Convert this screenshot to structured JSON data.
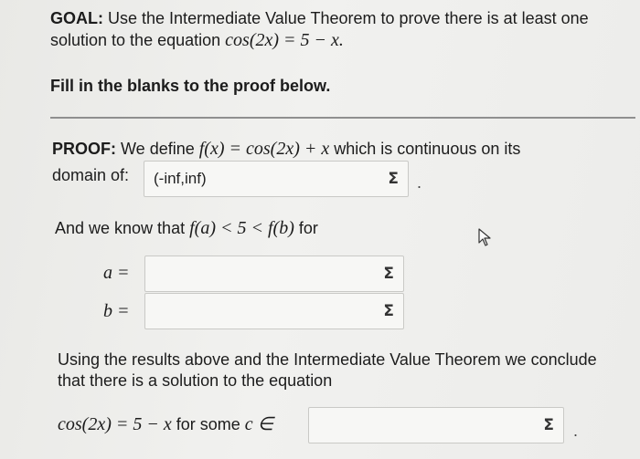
{
  "goal": {
    "label": "GOAL:",
    "text_line1": "Use the Intermediate Value Theorem to prove there is at least one",
    "text_line2": "solution to the equation",
    "equation": "cos(2x) = 5 − x."
  },
  "instruction": "Fill in the blanks to the proof below.",
  "proof": {
    "label": "PROOF:",
    "line1_text": "We define",
    "function_def": "f(x) = cos(2x) + x",
    "line1_tail": "which is continuous on its",
    "domain_label": "domain of:",
    "domain_value": "(-inf,inf)",
    "period": "."
  },
  "ivt_line": {
    "prefix": "And we know that",
    "inequality": "f(a) < 5 < f(b)",
    "suffix": "for"
  },
  "a_field": {
    "label": "a =",
    "value": ""
  },
  "b_field": {
    "label": "b =",
    "value": ""
  },
  "conclusion": {
    "line1": "Using the results above and the Intermediate Value Theorem we conclude",
    "line2": "that there is a solution to the equation",
    "equation": "cos(2x) = 5 − x",
    "for_some": "for some",
    "c_in": "c ∈",
    "value": "",
    "period": "."
  },
  "icons": {
    "sigma_symbol": "Σ",
    "sigma_icon": "sigma-icon",
    "cursor_icon": "mouse-pointer-icon"
  }
}
